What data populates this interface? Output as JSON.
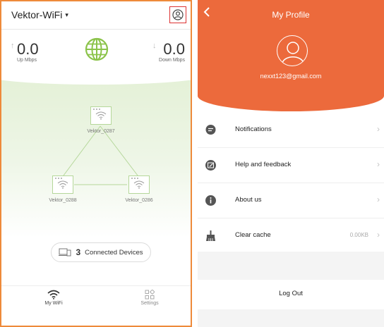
{
  "colors": {
    "accent": "#ec6a3c",
    "frame": "#ee8a3a",
    "green": "#8bc34a",
    "highlight": "#dd3333"
  },
  "wifi_screen": {
    "network_name": "Vektor-WiFi",
    "caret": "▾",
    "profile_icon": "user-circle-icon",
    "upload": {
      "value": "0.0",
      "unit": "Up Mbps"
    },
    "download": {
      "value": "0.0",
      "unit": "Down Mbps"
    },
    "nodes": [
      {
        "name": "Vektor_0287"
      },
      {
        "name": "Vektor_0288"
      },
      {
        "name": "Vektor_0286"
      }
    ],
    "connected": {
      "count": "3",
      "label": "Connected Devices"
    },
    "tabs": [
      {
        "label": "My WiFi",
        "icon": "wifi-icon",
        "active": true
      },
      {
        "label": "Settings",
        "icon": "grid-icon",
        "active": false
      }
    ]
  },
  "profile_screen": {
    "title": "My Profile",
    "back_icon": "chevron-left-icon",
    "email": "nexxt123@gmail.com",
    "menu": [
      {
        "label": "Notifications",
        "icon": "chat-bubble-icon",
        "value": ""
      },
      {
        "label": "Help and feedback",
        "icon": "feedback-icon",
        "value": ""
      },
      {
        "label": "About us",
        "icon": "info-icon",
        "value": ""
      },
      {
        "label": "Clear cache",
        "icon": "broom-icon",
        "value": "0.00KB"
      }
    ],
    "logout_label": "Log Out"
  }
}
